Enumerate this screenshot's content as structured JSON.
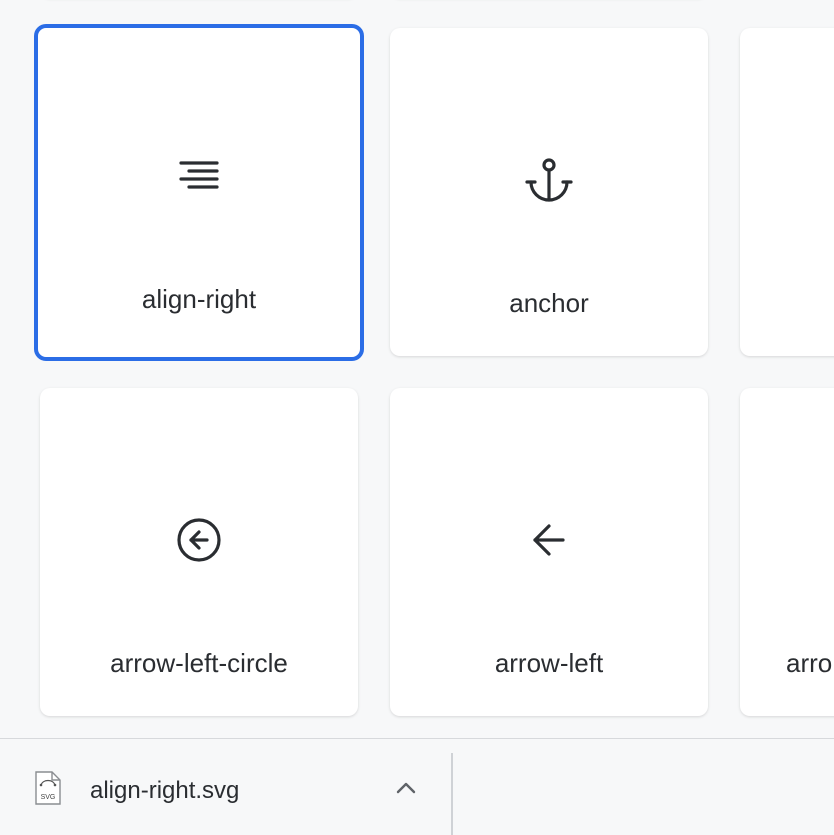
{
  "grid": {
    "cards": [
      {
        "label": "",
        "icon": "unknown-icon"
      },
      {
        "label": "",
        "icon": "unknown-icon"
      },
      {
        "label": "align-right",
        "icon": "align-right-icon",
        "selected": true
      },
      {
        "label": "anchor",
        "icon": "anchor-icon"
      },
      {
        "label": "",
        "icon": "unknown-icon"
      },
      {
        "label": "arrow-left-circle",
        "icon": "arrow-left-circle-icon"
      },
      {
        "label": "arrow-left",
        "icon": "arrow-left-icon"
      },
      {
        "label": "arrow-left",
        "icon": "arrow-left-icon"
      }
    ],
    "visible_labels": [
      "align-right",
      "anchor",
      "arrow-left-circle",
      "arrow-left",
      "arro"
    ]
  },
  "download_bar": {
    "filename": "align-right.svg",
    "file_icon": "svg-file-icon",
    "file_icon_text": "SVG",
    "menu_icon": "chevron-up-icon"
  },
  "colors": {
    "selection_border": "#2b6de6",
    "icon_stroke": "#2a2d31",
    "background": "#f7f8f9"
  }
}
